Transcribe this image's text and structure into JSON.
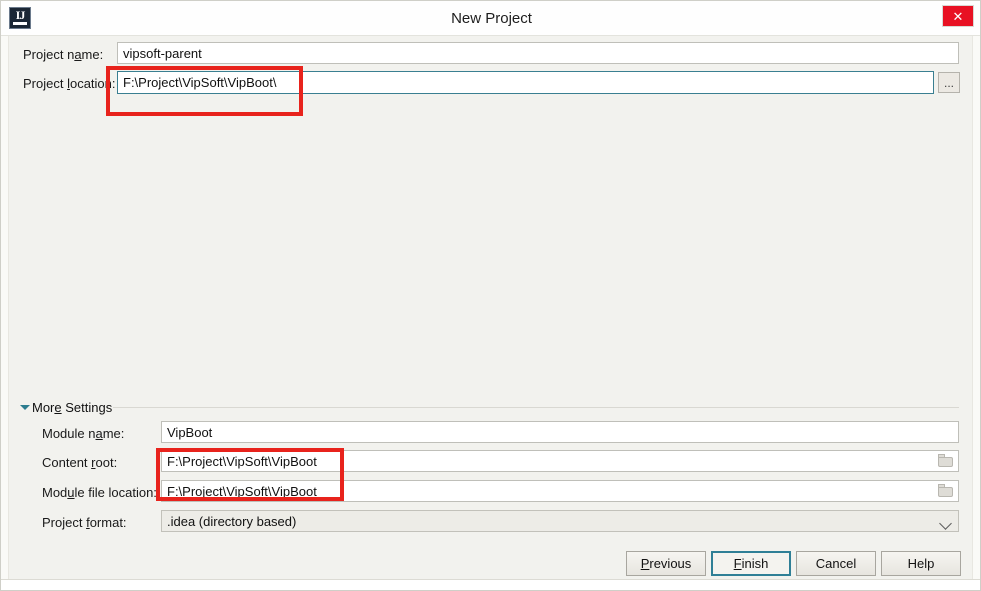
{
  "window": {
    "title": "New Project",
    "app_icon": "intellij-idea-icon",
    "close_label": "✕"
  },
  "main_form": {
    "project_name": {
      "label_pre": "Project n",
      "label_mnemonic": "a",
      "label_post": "me:",
      "value": "vipsoft-parent"
    },
    "project_location": {
      "label_pre": "Project ",
      "label_mnemonic": "l",
      "label_post": "ocation:",
      "value": "F:\\Project\\VipSoft\\VipBoot\\",
      "browse_label": "..."
    }
  },
  "more_settings": {
    "label_pre": "Mor",
    "label_mnemonic": "e",
    "label_post": " Settings",
    "expanded": true,
    "module_name": {
      "label_pre": "Module n",
      "label_mnemonic": "a",
      "label_post": "me:",
      "value": "VipBoot"
    },
    "content_root": {
      "label_pre": "Content ",
      "label_mnemonic": "r",
      "label_post": "oot:",
      "value": "F:\\Project\\VipSoft\\VipBoot"
    },
    "module_file_location": {
      "label_pre": "Mod",
      "label_mnemonic": "u",
      "label_post": "le file location:",
      "value": "F:\\Project\\VipSoft\\VipBoot"
    },
    "project_format": {
      "label_pre": "Project ",
      "label_mnemonic": "f",
      "label_post": "ormat:",
      "value": ".idea (directory based)"
    }
  },
  "buttons": {
    "previous": {
      "pre": "",
      "mnemonic": "P",
      "post": "revious"
    },
    "finish": {
      "pre": "",
      "mnemonic": "F",
      "post": "inish",
      "is_default": true
    },
    "cancel": {
      "pre": "Cancel",
      "mnemonic": "",
      "post": ""
    },
    "help": {
      "pre": "Help",
      "mnemonic": "",
      "post": ""
    }
  },
  "annotations": {
    "accent_color": "#e8231c",
    "boxes": [
      {
        "name": "project-location-highlight"
      },
      {
        "name": "paths-highlight"
      }
    ]
  }
}
